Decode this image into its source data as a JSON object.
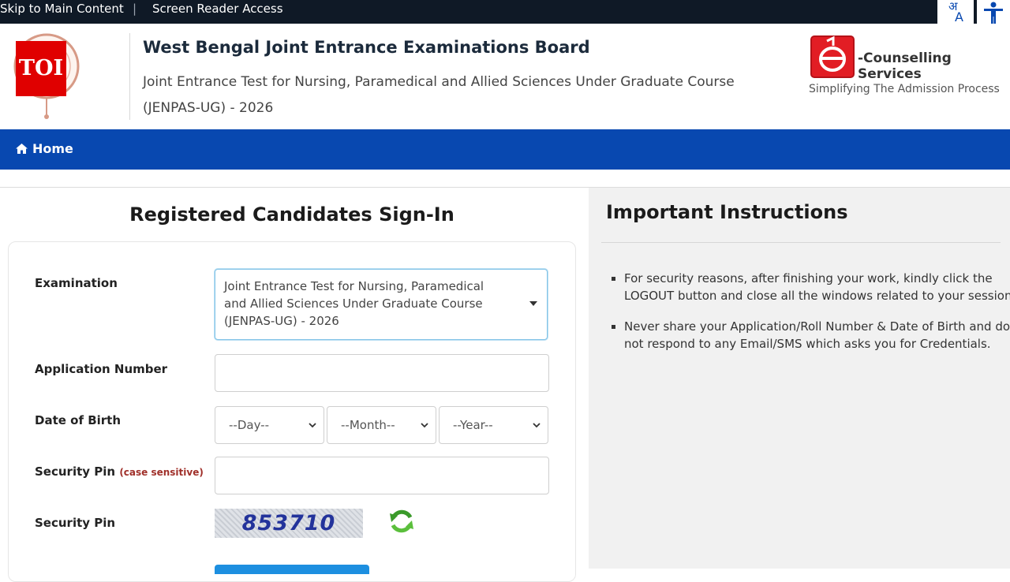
{
  "topbar": {
    "skip_link": "Skip to Main Content",
    "separator": "|",
    "screen_reader": "Screen Reader Access",
    "font_size_icon": "font-size-toggle-icon",
    "accessibility_icon": "accessibility-person-icon"
  },
  "header": {
    "overlay_badge": "TOI",
    "board_title": "West Bengal Joint Entrance Examinations Board",
    "board_subtitle": "Joint Entrance Test for Nursing, Paramedical and Allied Sciences Under Graduate Course (JENPAS-UG) - 2026",
    "ecounselling_name": "-Counselling Services",
    "ecounselling_tagline": "Simplifying The Admission Process"
  },
  "nav": {
    "home_label": "Home",
    "home_icon": "home-icon"
  },
  "signin": {
    "title": "Registered Candidates Sign-In",
    "examination_label": "Examination",
    "examination_value": "Joint Entrance Test for Nursing, Paramedical and Allied Sciences Under Graduate Course (JENPAS-UG) - 2026",
    "application_label": "Application Number",
    "application_value": "",
    "dob_label": "Date of Birth",
    "day_value": "--Day--",
    "month_value": "--Month--",
    "year_value": "--Year--",
    "pin_label": "Security Pin",
    "pin_note": "(case sensitive)",
    "pin_value": "",
    "captcha_label": "Security Pin",
    "captcha_text": "853710",
    "refresh_icon": "refresh-icon"
  },
  "instructions": {
    "title": "Important Instructions",
    "items": [
      "For security reasons, after finishing your work, kindly click the LOGOUT button and close all the windows related to your session.",
      "Never share your Application/Roll Number & Date of Birth and do not respond to any Email/SMS which asks you for Credentials."
    ]
  },
  "colors": {
    "topbar_bg": "#0f1926",
    "nav_bg": "#0848b0",
    "accent_button": "#1d8fe0",
    "captcha_text": "#23339b",
    "note_red": "#a0302a",
    "ecounselling_red": "#e21d24"
  }
}
